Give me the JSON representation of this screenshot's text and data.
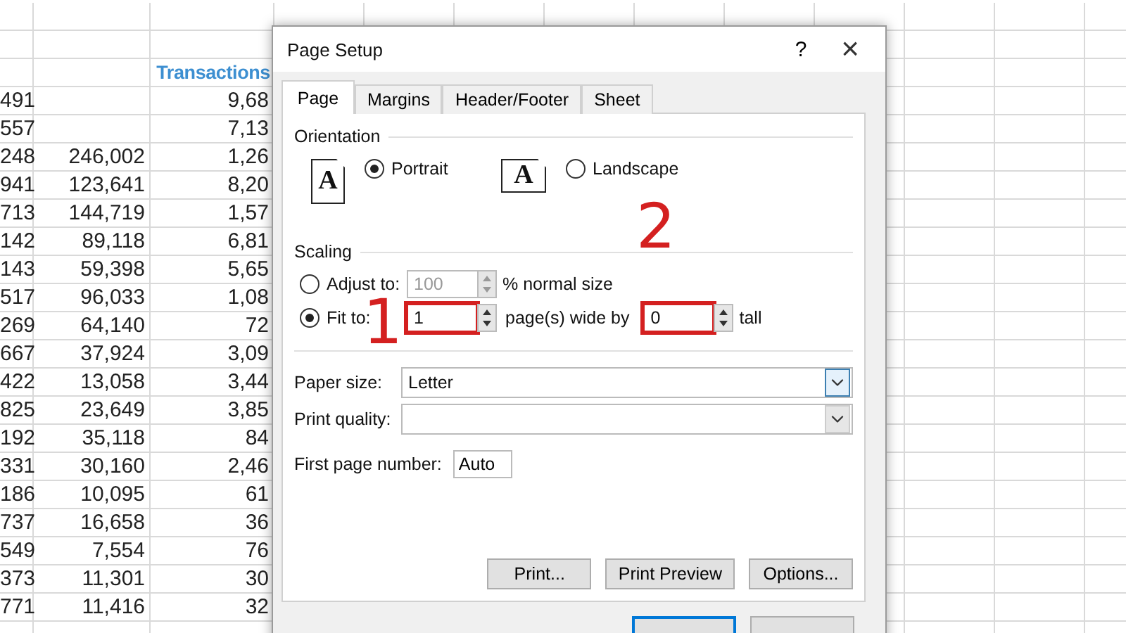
{
  "sheet": {
    "header": {
      "column_3": "Transactions"
    },
    "rows": [
      {
        "column_1": "491",
        "column_3": "9,68"
      },
      {
        "column_1": "557",
        "column_3": "7,13"
      },
      {
        "column_1": "248",
        "column_2": "246,002",
        "column_3": "1,26"
      },
      {
        "column_1": "941",
        "column_2": "123,641",
        "column_3": "8,20"
      },
      {
        "column_1": "713",
        "column_2": "144,719",
        "column_3": "1,57"
      },
      {
        "column_1": "142",
        "column_2": "89,118",
        "column_3": "6,81"
      },
      {
        "column_1": "143",
        "column_2": "59,398",
        "column_3": "5,65"
      },
      {
        "column_1": "517",
        "column_2": "96,033",
        "column_3": "1,08"
      },
      {
        "column_1": "269",
        "column_2": "64,140",
        "column_3": "72"
      },
      {
        "column_1": "667",
        "column_2": "37,924",
        "column_3": "3,09"
      },
      {
        "column_1": "422",
        "column_2": "13,058",
        "column_3": "3,44"
      },
      {
        "column_1": "825",
        "column_2": "23,649",
        "column_3": "3,85"
      },
      {
        "column_1": "192",
        "column_2": "35,118",
        "column_3": "84"
      },
      {
        "column_1": "331",
        "column_2": "30,160",
        "column_3": "2,46"
      },
      {
        "column_1": "186",
        "column_2": "10,095",
        "column_3": "61"
      },
      {
        "column_1": "737",
        "column_2": "16,658",
        "column_3": "36"
      },
      {
        "column_1": "549",
        "column_2": "7,554",
        "column_3": "76"
      },
      {
        "column_1": "373",
        "column_2": "11,301",
        "column_3": "30"
      },
      {
        "column_1": "771",
        "column_2": "11,416",
        "column_3": "32"
      }
    ]
  },
  "dialog": {
    "title": "Page Setup",
    "help": "?",
    "close": "×",
    "tabs": [
      {
        "label": "Page",
        "selected": true
      },
      {
        "label": "Margins",
        "selected": false
      },
      {
        "label": "Header/Footer",
        "selected": false
      },
      {
        "label": "Sheet",
        "selected": false
      }
    ],
    "orientation": {
      "label": "Orientation",
      "options": [
        {
          "label": "Portrait",
          "glyph": "A",
          "selected": true
        },
        {
          "label": "Landscape",
          "glyph": "A",
          "selected": false
        }
      ]
    },
    "scaling": {
      "label": "Scaling",
      "adjust": {
        "label": "Adjust to:",
        "selected": false,
        "value": "100",
        "disabled": true,
        "suffix": "% normal size"
      },
      "fit": {
        "label": "Fit to:",
        "selected": true,
        "wide": {
          "value": "1",
          "highlighted": true
        },
        "wide_suffix": "page(s) wide by",
        "tall": {
          "value": "0",
          "highlighted": true
        },
        "tall_suffix": "tall"
      }
    },
    "paper_size": {
      "label": "Paper size:",
      "value": "Letter",
      "focused": true
    },
    "print_quality": {
      "label": "Print quality:",
      "focused": false
    },
    "first_page_number": {
      "label": "First page number:",
      "value": "Auto"
    },
    "buttons": [
      "Print...",
      "Print Preview",
      "Options..."
    ],
    "footer_buttons": [
      {
        "default": true
      },
      {
        "default": false
      }
    ]
  },
  "annotations": [
    {
      "text": "1"
    },
    {
      "text": "2"
    }
  ]
}
